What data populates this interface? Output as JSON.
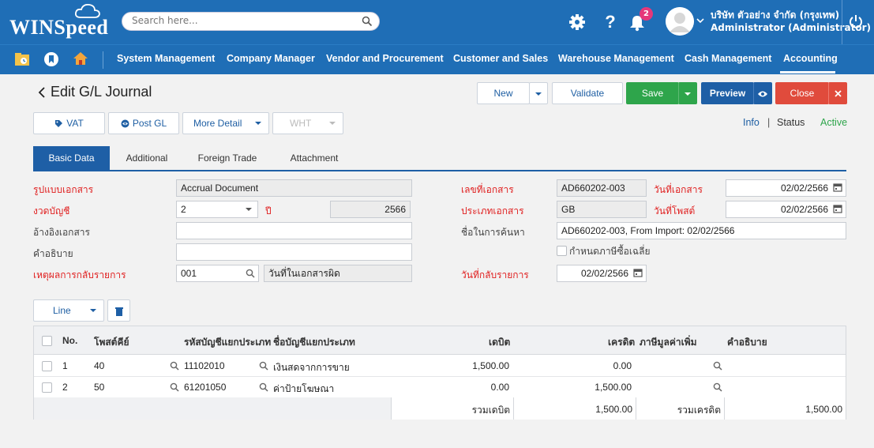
{
  "app": {
    "brand": "WINSpeed",
    "search_placeholder": "Search here...",
    "notification_count": "2",
    "company_name": "บริษัท ตัวอย่าง จำกัด (กรุงเทพ)",
    "user_name": "Administrator (Administrator)"
  },
  "nav": {
    "items": [
      "System Management",
      "Company Manager",
      "Vendor and Procurement",
      "Customer and Sales",
      "Warehouse Management",
      "Cash Management",
      "Accounting"
    ],
    "active": "Accounting"
  },
  "page": {
    "title": "Edit G/L Journal",
    "buttons": {
      "new": "New",
      "validate": "Validate",
      "save": "Save",
      "preview": "Preview",
      "close": "Close",
      "vat": "VAT",
      "post_gl": "Post GL",
      "more_detail": "More Detail",
      "wht": "WHT"
    },
    "info_link": "Info",
    "status_label": "Status",
    "status_value": "Active"
  },
  "tabs": [
    "Basic Data",
    "Additional",
    "Foreign Trade",
    "Attachment"
  ],
  "form": {
    "doc_format_label": "รูปแบบเอกสาร",
    "doc_format_value": "Accrual Document",
    "period_label": "งวดบัญชี",
    "period_value": "2",
    "year_label": "ปี",
    "year_value": "2566",
    "ref_doc_label": "อ้างอิงเอกสาร",
    "ref_doc_value": "",
    "description_label": "คำอธิบาย",
    "description_value": "",
    "reverse_reason_label": "เหตุผลการกลับรายการ",
    "reverse_reason_code": "001",
    "reverse_reason_desc": "วันที่ในเอกสารผิด",
    "doc_no_label": "เลขที่เอกสาร",
    "doc_no_value": "AD660202-003",
    "doc_date_label": "วันที่เอกสาร",
    "doc_date_value": "02/02/2566",
    "doc_type_label": "ประเภทเอกสาร",
    "doc_type_value": "GB",
    "post_date_label": "วันที่โพสต์",
    "post_date_value": "02/02/2566",
    "search_name_label": "ชื่อในการค้นหา",
    "search_name_value": "AD660202-003, From Import: 02/02/2566",
    "avg_tax_label": "กำหนดภาษีซื้อเฉลี่ย",
    "reverse_date_label": "วันที่กลับรายการ",
    "reverse_date_value": "02/02/2566"
  },
  "grid": {
    "line_button": "Line",
    "columns": [
      "No.",
      "โพสต์คีย์",
      "รหัสบัญชีแยกประเภท",
      "ชื่อบัญชีแยกประเภท",
      "เดบิต",
      "เครดิต",
      "ภาษีมูลค่าเพิ่ม",
      "คำอธิบาย"
    ],
    "rows": [
      {
        "no": "1",
        "post_key": "40",
        "account_code": "11102010",
        "account_name": "เงินสดจากการขาย",
        "debit": "1,500.00",
        "credit": "0.00"
      },
      {
        "no": "2",
        "post_key": "50",
        "account_code": "61201050",
        "account_name": "ค่าป้ายโฆษณา",
        "debit": "0.00",
        "credit": "1,500.00"
      }
    ],
    "total_debit_label": "รวมเดบิต",
    "total_debit_value": "1,500.00",
    "total_credit_label": "รวมเครดิต",
    "total_credit_value": "1,500.00"
  },
  "colors": {
    "header_blue": "#1f6eb6",
    "primary_blue": "#1e5fa6",
    "save_green": "#2ea54b",
    "close_red": "#e04b3c",
    "required_red": "#e02020",
    "status_green": "#2ea54b"
  }
}
